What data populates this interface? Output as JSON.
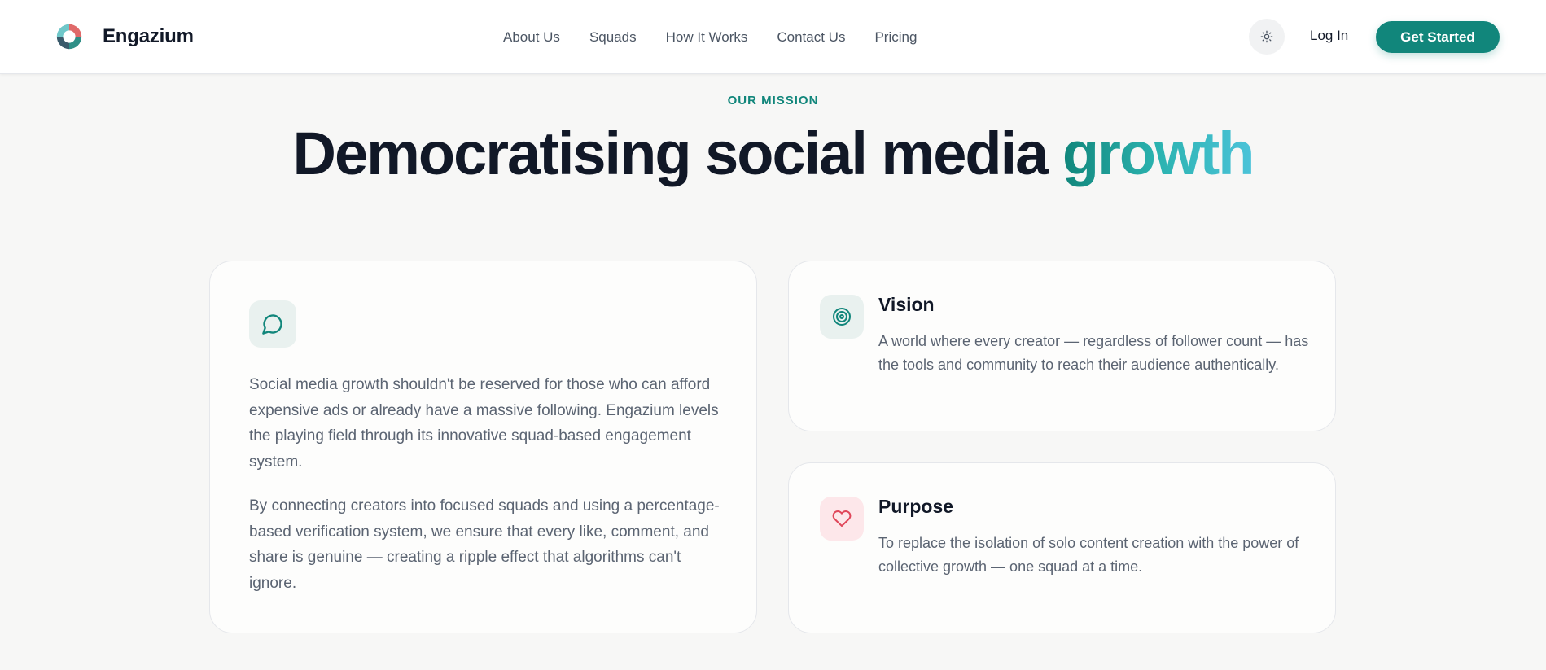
{
  "header": {
    "brand_name": "Engazium",
    "nav": [
      "About Us",
      "Squads",
      "How It Works",
      "Contact Us",
      "Pricing"
    ],
    "login_label": "Log In",
    "cta_label": "Get Started",
    "theme_icon": "sun-icon"
  },
  "hero": {
    "eyebrow": "OUR MISSION",
    "title_main": "Democratising social media ",
    "title_accent": "growth"
  },
  "mission_card": {
    "icon": "message-circle-icon",
    "paragraph_1": "Social media growth shouldn't be reserved for those who can afford expensive ads or already have a massive following. Engazium levels the playing field through its innovative squad-based engagement system.",
    "paragraph_2": "By connecting creators into focused squads and using a percentage-based verification system, we ensure that every like, comment, and share is genuine — creating a ripple effect that algorithms can't ignore."
  },
  "vision_card": {
    "icon": "target-icon",
    "title": "Vision",
    "text": "A world where every creator — regardless of follower count — has the tools and community to reach their audience authentically."
  },
  "purpose_card": {
    "icon": "heart-icon",
    "title": "Purpose",
    "text": "To replace the isolation of solo content creation with the power of collective growth — one squad at a time."
  },
  "colors": {
    "brand": "#11867b",
    "accent_gradient_end": "#4cc3d9",
    "heart": "#e0475a",
    "background": "#f7f7f6"
  }
}
